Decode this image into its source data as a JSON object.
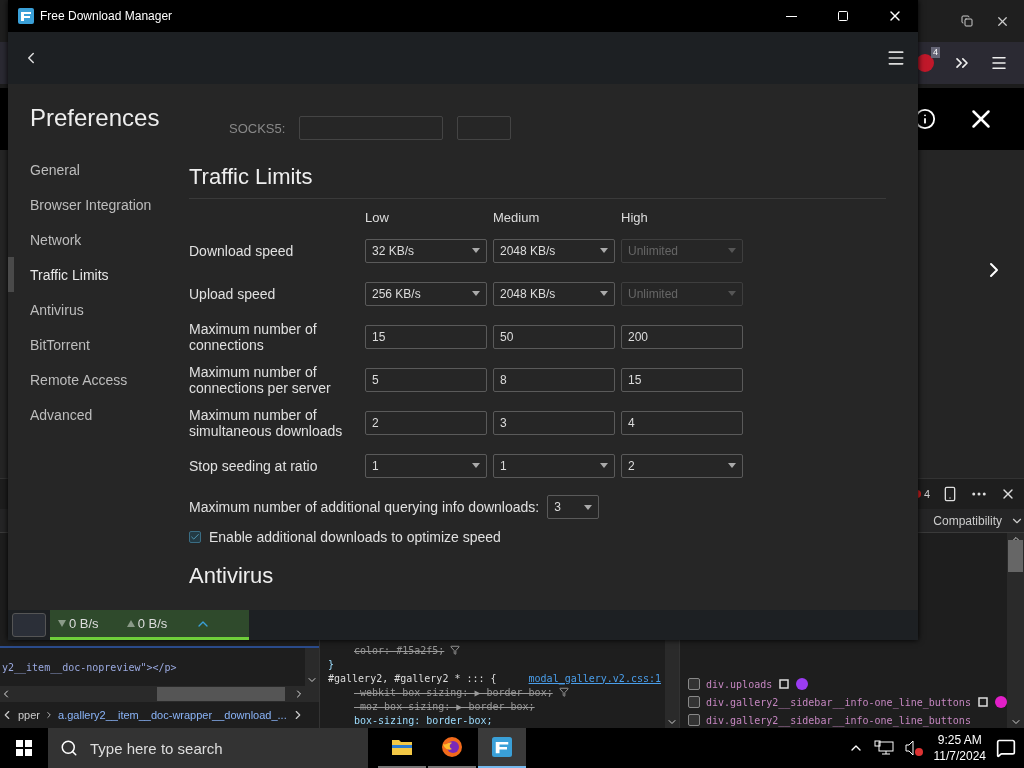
{
  "browser": {
    "extension_badge": "4"
  },
  "devtools": {
    "issue_count": "4",
    "tab": "Compatibility",
    "code_line": "y2__item__doc-nopreview\"></p>",
    "breadcrumb": [
      "pper",
      "a.gallery2__item__doc-wrapper__download_..."
    ],
    "style_lines": [
      {
        "kind": "property",
        "text": "color: #15a2f5;",
        "struck": true
      },
      {
        "kind": "brace",
        "text": "}",
        "struck": false
      },
      {
        "kind": "selector",
        "text": "#gallery2, #gallery2 * ::: {",
        "link": "modal_gallery.v2.css:1",
        "struck": false
      },
      {
        "kind": "property",
        "text": "-webkit-box-sizing: ▶ border-box;",
        "struck": true
      },
      {
        "kind": "property",
        "text": "-moz-box-sizing: ▶ border-box;",
        "struck": true
      },
      {
        "kind": "property",
        "text": "box-sizing: border-box;",
        "struck": false
      }
    ],
    "dom_list": [
      {
        "text": "div.uploads",
        "color": "#9b3cf2",
        "checked": false
      },
      {
        "text": "div.gallery2__sidebar__info-one_line_buttons",
        "color": "#e21fc8",
        "checked": false
      },
      {
        "text": "div.gallery2__sidebar__info-one_line_buttons",
        "checked": false
      }
    ]
  },
  "window": {
    "title": "Free Download Manager"
  },
  "sidebar": {
    "title": "Preferences",
    "items": [
      {
        "label": "General",
        "selected": false
      },
      {
        "label": "Browser Integration",
        "selected": false
      },
      {
        "label": "Network",
        "selected": false
      },
      {
        "label": "Traffic Limits",
        "selected": true
      },
      {
        "label": "Antivirus",
        "selected": false
      },
      {
        "label": "BitTorrent",
        "selected": false
      },
      {
        "label": "Remote Access",
        "selected": false
      },
      {
        "label": "Advanced",
        "selected": false
      }
    ]
  },
  "proxy_row": {
    "label": "SOCKS5:"
  },
  "section": {
    "title": "Traffic Limits",
    "columns": [
      "Low",
      "Medium",
      "High"
    ],
    "rows": [
      {
        "label": "Download speed",
        "cells": [
          {
            "kind": "dropdown",
            "value": "32 KB/s",
            "disabled": false
          },
          {
            "kind": "dropdown",
            "value": "2048 KB/s",
            "disabled": false
          },
          {
            "kind": "dropdown",
            "value": "Unlimited",
            "disabled": true
          }
        ]
      },
      {
        "label": "Upload speed",
        "cells": [
          {
            "kind": "dropdown",
            "value": "256 KB/s",
            "disabled": false
          },
          {
            "kind": "dropdown",
            "value": "2048 KB/s",
            "disabled": false
          },
          {
            "kind": "dropdown",
            "value": "Unlimited",
            "disabled": true
          }
        ]
      },
      {
        "label": "Maximum number of connections",
        "cells": [
          {
            "kind": "input",
            "value": "15",
            "disabled": false
          },
          {
            "kind": "input",
            "value": "50",
            "disabled": false
          },
          {
            "kind": "input",
            "value": "200",
            "disabled": false
          }
        ]
      },
      {
        "label": "Maximum number of connections per server",
        "cells": [
          {
            "kind": "input",
            "value": "5",
            "disabled": false
          },
          {
            "kind": "input",
            "value": "8",
            "disabled": false
          },
          {
            "kind": "input",
            "value": "15",
            "disabled": false
          }
        ]
      },
      {
        "label": "Maximum number of simultaneous downloads",
        "cells": [
          {
            "kind": "input",
            "value": "2",
            "disabled": false
          },
          {
            "kind": "input",
            "value": "3",
            "disabled": false
          },
          {
            "kind": "input",
            "value": "4",
            "disabled": false
          }
        ]
      },
      {
        "label": "Stop seeding at ratio",
        "cells": [
          {
            "kind": "dropdown",
            "value": "1",
            "disabled": false
          },
          {
            "kind": "dropdown",
            "value": "1",
            "disabled": false
          },
          {
            "kind": "dropdown",
            "value": "2",
            "disabled": false
          }
        ]
      }
    ]
  },
  "query_row": {
    "label": "Maximum number of additional querying info downloads:",
    "value": "3"
  },
  "option": {
    "label": "Enable additional downloads to optimize speed",
    "checked": true
  },
  "next_section": {
    "title": "Antivirus"
  },
  "status_bar": {
    "download": "0 B/s",
    "upload": "0 B/s"
  },
  "taskbar": {
    "search_placeholder": "Type here to search",
    "apps": [
      {
        "kind": "explorer",
        "selected": false
      },
      {
        "kind": "firefox",
        "selected": false
      },
      {
        "kind": "fdm",
        "selected": true
      }
    ],
    "time": "9:25 AM",
    "date": "11/7/2024"
  }
}
